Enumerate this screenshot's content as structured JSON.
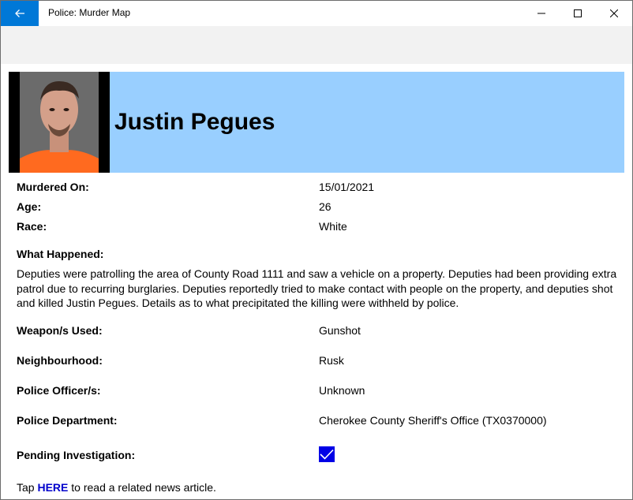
{
  "window": {
    "title": "Police: Murder Map"
  },
  "profile": {
    "name": "Justin Pegues",
    "photo_icon": "person-photo"
  },
  "details": {
    "murdered_on_label": "Murdered On:",
    "murdered_on_value": "15/01/2021",
    "age_label": "Age:",
    "age_value": "26",
    "race_label": "Race:",
    "race_value": "White",
    "what_happened_label": "What Happened:",
    "what_happened_text": "Deputies were patrolling the area of County Road 1111 and saw a vehicle on a property. Deputies had been providing extra patrol due to recurring burglaries. Deputies reportedly tried to make contact with people on the property, and deputies shot and killed Justin Pegues. Details as to what precipitated the killing were withheld by police.",
    "weapon_label": "Weapon/s Used:",
    "weapon_value": "Gunshot",
    "neighbourhood_label": "Neighbourhood:",
    "neighbourhood_value": "Rusk",
    "officer_label": "Police Officer/s:",
    "officer_value": "Unknown",
    "department_label": "Police Department:",
    "department_value": "Cherokee County Sheriff's Office (TX0370000)",
    "pending_label": "Pending Investigation:",
    "pending_checked": true
  },
  "footer": {
    "prefix": "Tap ",
    "link_text": "HERE",
    "suffix": " to read a related news article."
  },
  "colors": {
    "accent": "#0078d7",
    "header_band": "#99cfff",
    "checkbox": "#0000e6",
    "link": "#0000cc"
  }
}
